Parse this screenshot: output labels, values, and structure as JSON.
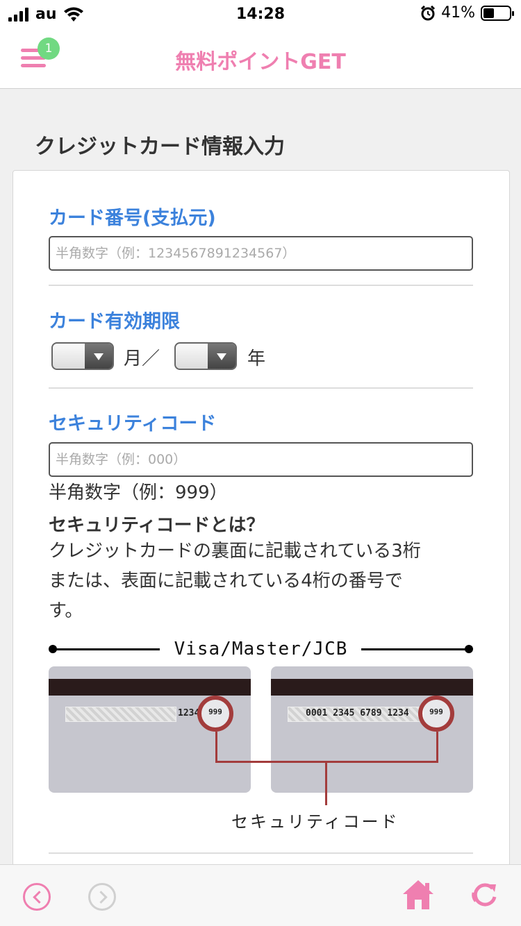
{
  "status_bar": {
    "carrier": "au",
    "time": "14:28",
    "battery": "41%",
    "battery_level": 0.41
  },
  "header": {
    "title": "無料ポイントGET",
    "badge_count": "1"
  },
  "section_title": "クレジットカード情報入力",
  "form": {
    "card_number_label": "カード番号(支払元)",
    "card_number_placeholder": "半角数字（例：1234567891234567）",
    "expiry_label": "カード有効期限",
    "month_suffix": "月／",
    "year_suffix": "年",
    "security_label": "セキュリティコード",
    "security_placeholder": "半角数字（例：000）",
    "security_hint": "半角数字（例：999）",
    "security_what_title": "セキュリティコードとは？",
    "security_desc_1": "クレジットカードの裏面に記載されている3桁",
    "security_desc_2": "または、表面に記載されている4桁の番号で",
    "security_desc_3": "す。"
  },
  "illustration": {
    "brands": "Visa/Master/JCB",
    "back_card_number": "1234",
    "back_card_code": "999",
    "front_card_number": "0001 2345 6789 1234",
    "front_card_code": "999",
    "caption": "セキュリティコード"
  },
  "colors": {
    "accent_pink": "#ef7fb0",
    "label_blue": "#3c82dc",
    "badge_green": "#71d982",
    "code_ring": "#a33c3c"
  },
  "bottom_nav": {
    "back_icon": "chevron-left-circle-icon",
    "forward_icon": "chevron-right-circle-icon",
    "home_icon": "home-icon",
    "reload_icon": "reload-icon"
  }
}
